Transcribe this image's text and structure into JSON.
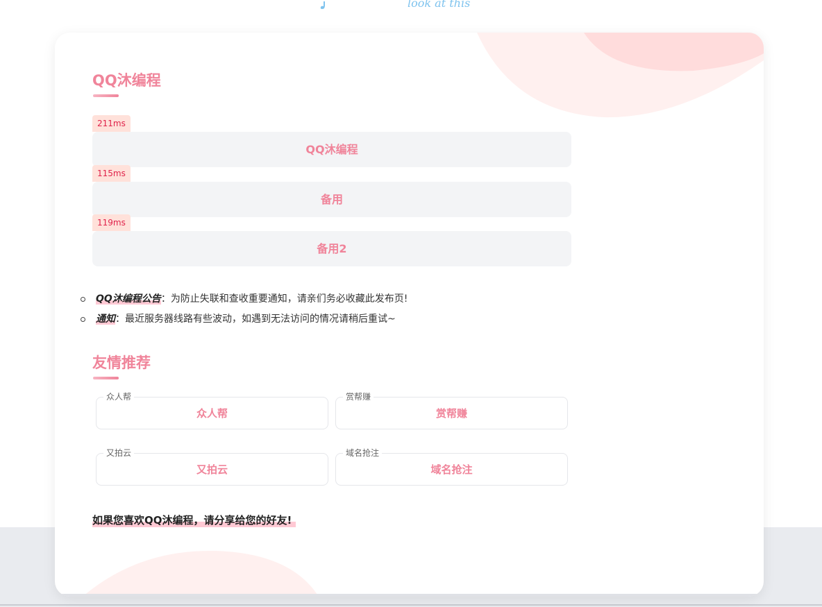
{
  "header": {
    "deco_text": "look at this"
  },
  "colors": {
    "accent": "#f0849a",
    "ping_bg": "#ffe1da",
    "ping_text": "#e0224a",
    "button_bg": "#f3f4f6",
    "highlight": "#ffc9d4"
  },
  "main": {
    "title": "QQ沐编程",
    "lines": [
      {
        "ping": "211ms",
        "label": "QQ沐编程"
      },
      {
        "ping": "115ms",
        "label": "备用"
      },
      {
        "ping": "119ms",
        "label": "备用2"
      }
    ]
  },
  "notices": [
    {
      "label": "QQ沐编程公告",
      "separator": "：",
      "text": "为防止失联和查收重要通知，请亲们务必收藏此发布页!"
    },
    {
      "label": "通知",
      "separator": "：",
      "text": "最近服务器线路有些波动，如遇到无法访问的情况请稍后重试~"
    }
  ],
  "friends": {
    "title": "友情推荐",
    "items": [
      {
        "legend": "众人帮",
        "name": "众人帮"
      },
      {
        "legend": "赏帮赚",
        "name": "赏帮赚"
      },
      {
        "legend": "又拍云",
        "name": "又拍云"
      },
      {
        "legend": "域名抢注",
        "name": "域名抢注"
      }
    ]
  },
  "footer": {
    "share_text": "如果您喜欢QQ沐编程，请分享给您的好友!"
  }
}
